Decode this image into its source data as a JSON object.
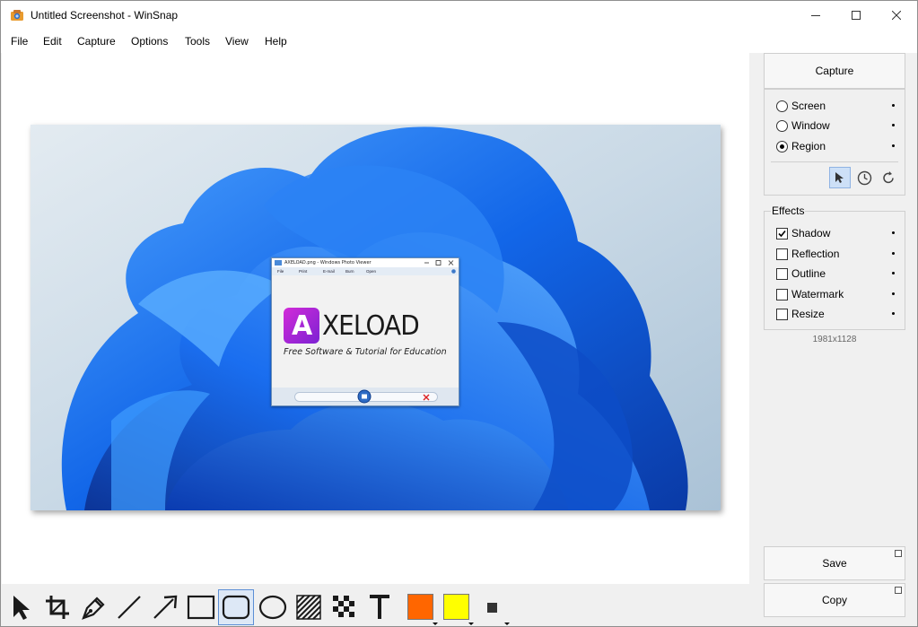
{
  "window": {
    "title": "Untitled Screenshot - WinSnap"
  },
  "menu": [
    "File",
    "Edit",
    "Capture",
    "Options",
    "Tools",
    "View",
    "Help"
  ],
  "capture_panel": {
    "capture_button": "Capture",
    "modes": [
      {
        "label": "Screen",
        "selected": false
      },
      {
        "label": "Window",
        "selected": false
      },
      {
        "label": "Region",
        "selected": true
      }
    ],
    "mode_icons": [
      "cursor-icon",
      "timer-icon",
      "repeat-icon"
    ]
  },
  "effects": {
    "label": "Effects",
    "items": [
      {
        "label": "Shadow",
        "checked": true
      },
      {
        "label": "Reflection",
        "checked": false
      },
      {
        "label": "Outline",
        "checked": false
      },
      {
        "label": "Watermark",
        "checked": false
      },
      {
        "label": "Resize",
        "checked": false
      }
    ]
  },
  "image_size": "1981x1128",
  "actions": {
    "save": "Save",
    "copy": "Copy"
  },
  "photo_viewer": {
    "title": "AXELOAD.png - Windows Photo Viewer",
    "toolbar": [
      "File",
      "Print",
      "E-mail",
      "Burn",
      "Open"
    ],
    "logo_text": "XELOAD",
    "logo_letter": "A",
    "logo_subtitle": "Free Software & Tutorial for Education"
  },
  "toolbar": {
    "tools": [
      "pointer",
      "crop",
      "pen",
      "line",
      "arrow",
      "rectangle",
      "rounded-rectangle",
      "ellipse",
      "hatch",
      "pixelate",
      "text"
    ],
    "selected_tool": "rounded-rectangle",
    "primary_color": "#ff6600",
    "secondary_color": "#ffff00"
  }
}
